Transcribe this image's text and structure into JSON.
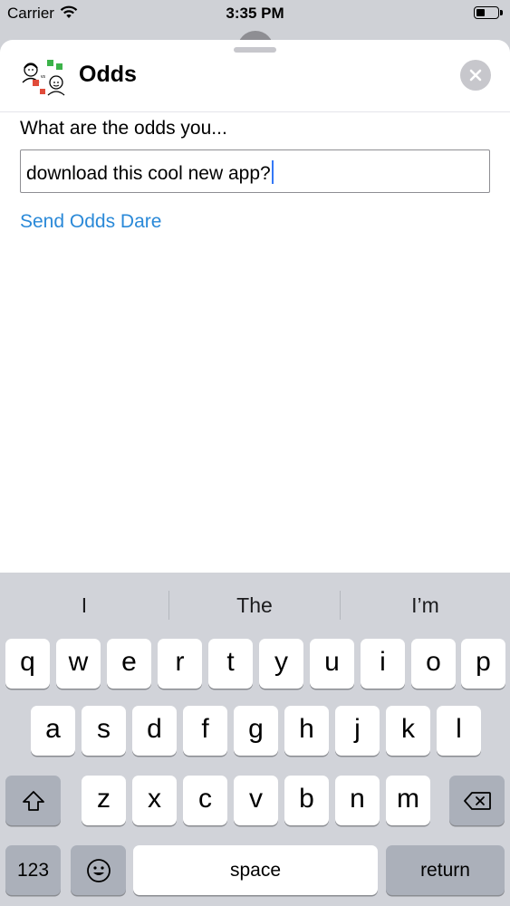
{
  "status_bar": {
    "carrier": "Carrier",
    "time": "3:35 PM"
  },
  "header": {
    "app_title": "Odds",
    "icon": "odds-app-logo",
    "close_icon": "close-icon"
  },
  "form": {
    "prompt_label": "What are the odds you...",
    "dare_text": "download this cool new app?",
    "send_label": "Send Odds Dare"
  },
  "keyboard": {
    "suggestions": [
      "I",
      "The",
      "I’m"
    ],
    "row1": [
      "q",
      "w",
      "e",
      "r",
      "t",
      "y",
      "u",
      "i",
      "o",
      "p"
    ],
    "row2": [
      "a",
      "s",
      "d",
      "f",
      "g",
      "h",
      "j",
      "k",
      "l"
    ],
    "row3": [
      "z",
      "x",
      "c",
      "v",
      "b",
      "n",
      "m"
    ],
    "numbers_label": "123",
    "space_label": "space",
    "return_label": "return"
  },
  "colors": {
    "link": "#2a89d8",
    "caret": "#3478f6",
    "keyboard_bg": "#d1d3d9"
  }
}
